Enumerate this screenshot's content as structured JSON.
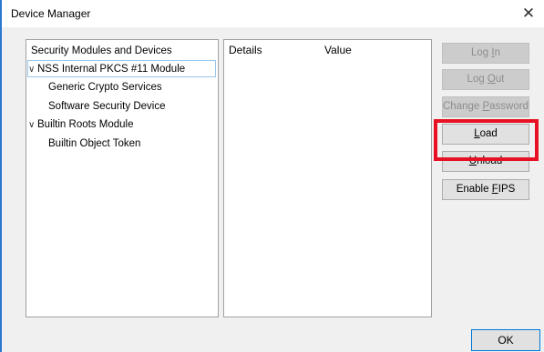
{
  "window": {
    "title": "Device Manager",
    "close_glyph": "✕"
  },
  "tree": {
    "header": "Security Modules and Devices",
    "items": [
      {
        "label": "NSS Internal PKCS #11 Module",
        "level": 0,
        "expanded": true,
        "selected": true
      },
      {
        "label": "Generic Crypto Services",
        "level": 1
      },
      {
        "label": "Software Security Device",
        "level": 1
      },
      {
        "label": "Builtin Roots Module",
        "level": 0,
        "expanded": true
      },
      {
        "label": "Builtin Object Token",
        "level": 1
      }
    ]
  },
  "details": {
    "col_details": "Details",
    "col_value": "Value"
  },
  "buttons": {
    "login": {
      "pre": "Log ",
      "key": "I",
      "post": "n",
      "enabled": false
    },
    "logout": {
      "pre": "Log ",
      "key": "O",
      "post": "ut",
      "enabled": false
    },
    "change_password": {
      "pre": "Change ",
      "key": "P",
      "post": "assword",
      "enabled": false
    },
    "load": {
      "pre": "",
      "key": "L",
      "post": "oad",
      "enabled": true
    },
    "unload": {
      "pre": "",
      "key": "U",
      "post": "nload",
      "enabled": true
    },
    "enable_fips": {
      "pre": "Enable ",
      "key": "F",
      "post": "IPS",
      "enabled": true
    },
    "ok": "OK"
  },
  "colors": {
    "highlight": "#e81123",
    "accent": "#2b79d0"
  },
  "icons": {
    "expand": "chevron-down-icon",
    "close": "close-icon"
  },
  "glyphs": {
    "chevron": "∨"
  }
}
